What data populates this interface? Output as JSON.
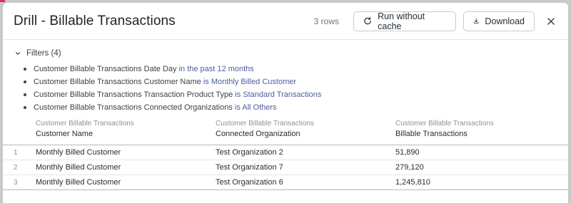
{
  "modal": {
    "title": "Drill - Billable Transactions",
    "row_count": "3 rows",
    "run_button": "Run without cache",
    "download_button": "Download"
  },
  "filters": {
    "label": "Filters (4)",
    "items": [
      {
        "field": "Customer Billable Transactions Date Day",
        "operator": "in the past 12 months"
      },
      {
        "field": "Customer Billable Transactions Customer Name",
        "operator": "is Monthly Billed Customer"
      },
      {
        "field": "Customer Billable Transactions Transaction Product Type",
        "operator": "is Standard Transactions"
      },
      {
        "field": "Customer Billable Transactions Connected Organizations",
        "operator": "is All Others"
      }
    ]
  },
  "table": {
    "columns": [
      {
        "group": "Customer Billable Transactions",
        "label": "Customer Name"
      },
      {
        "group": "Customer Billable Transactions",
        "label": "Connected Organization"
      },
      {
        "group": "Customer Billable Transactions",
        "label": "Billable Transactions"
      }
    ],
    "rows": [
      {
        "index": "1",
        "customer": "Monthly Billed Customer",
        "org": "Test Organization 2",
        "value": "51,890"
      },
      {
        "index": "2",
        "customer": "Monthly Billed Customer",
        "org": "Test Organization 7",
        "value": "279,120"
      },
      {
        "index": "3",
        "customer": "Monthly Billed Customer",
        "org": "Test Organization 6",
        "value": "1,245,810"
      }
    ]
  },
  "icons": {
    "run": "refresh-icon",
    "download": "download-icon",
    "close": "close-icon",
    "filters_toggle": "chevron-down-icon"
  },
  "colors": {
    "filter_value": "#4d5da0",
    "accent_mark": "#d8325a"
  }
}
